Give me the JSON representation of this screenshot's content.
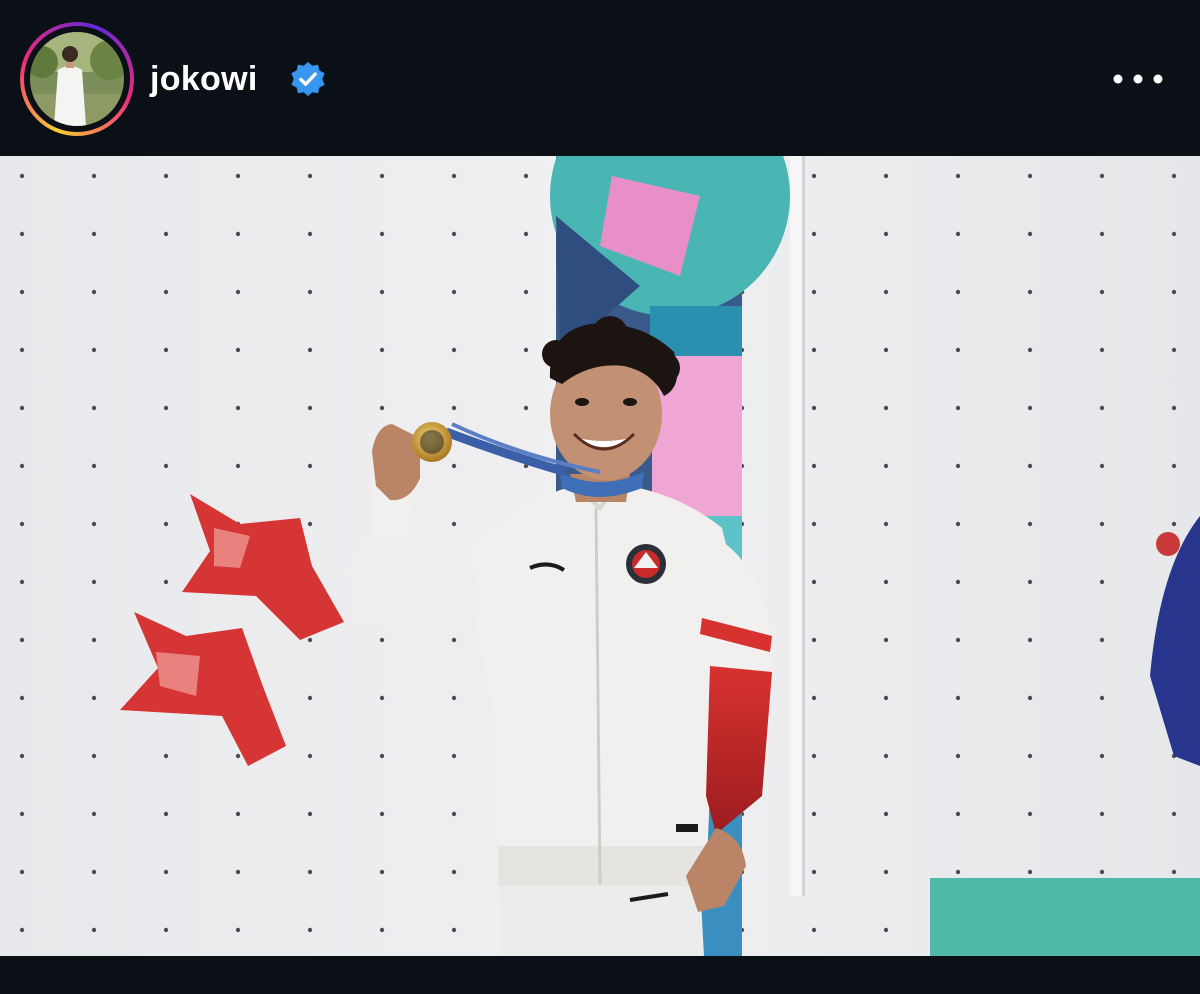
{
  "header": {
    "username": "jokowi",
    "verified": true,
    "avatar_icon": "profile-photo",
    "more_icon": "more-horizontal-icon"
  },
  "post": {
    "media_type": "photo",
    "image_subject": "athlete-with-gold-medal"
  },
  "colors": {
    "background": "#0b1016",
    "text": "#ffffff",
    "verified_badge": "#3797f0",
    "story_ring": [
      "#f9ce34",
      "#ee2a7b",
      "#6228d7"
    ]
  }
}
